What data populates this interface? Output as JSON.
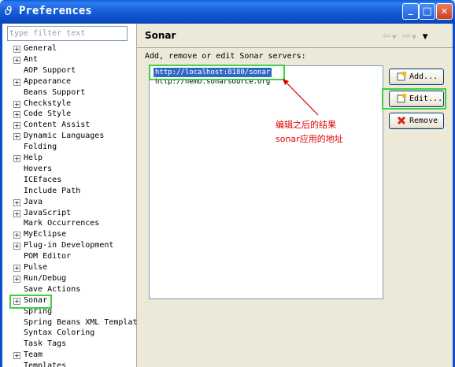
{
  "window": {
    "title": "Preferences",
    "minimize_glyph": "_",
    "maximize_glyph": "□",
    "close_glyph": "✕"
  },
  "filter": {
    "placeholder": "type filter text"
  },
  "tree": {
    "items": [
      {
        "label": "General",
        "expandable": true
      },
      {
        "label": "Ant",
        "expandable": true
      },
      {
        "label": "AOP Support",
        "expandable": false
      },
      {
        "label": "Appearance",
        "expandable": true
      },
      {
        "label": "Beans Support",
        "expandable": false
      },
      {
        "label": "Checkstyle",
        "expandable": true
      },
      {
        "label": "Code Style",
        "expandable": true
      },
      {
        "label": "Content Assist",
        "expandable": true
      },
      {
        "label": "Dynamic Languages",
        "expandable": true
      },
      {
        "label": "Folding",
        "expandable": false
      },
      {
        "label": "Help",
        "expandable": true
      },
      {
        "label": "Hovers",
        "expandable": false
      },
      {
        "label": "ICEfaces",
        "expandable": false
      },
      {
        "label": "Include Path",
        "expandable": false
      },
      {
        "label": "Java",
        "expandable": true
      },
      {
        "label": "JavaScript",
        "expandable": true
      },
      {
        "label": "Mark Occurrences",
        "expandable": false
      },
      {
        "label": "MyEclipse",
        "expandable": true
      },
      {
        "label": "Plug-in Development",
        "expandable": true
      },
      {
        "label": "POM Editor",
        "expandable": false
      },
      {
        "label": "Pulse",
        "expandable": true
      },
      {
        "label": "Run/Debug",
        "expandable": true
      },
      {
        "label": "Save Actions",
        "expandable": false
      },
      {
        "label": "Sonar",
        "expandable": true
      },
      {
        "label": "Spring",
        "expandable": false
      },
      {
        "label": "Spring Beans XML Templat",
        "expandable": false
      },
      {
        "label": "Syntax Coloring",
        "expandable": false
      },
      {
        "label": "Task Tags",
        "expandable": false
      },
      {
        "label": "Team",
        "expandable": true
      },
      {
        "label": "Templates",
        "expandable": false
      }
    ],
    "selected": "Sonar"
  },
  "page": {
    "title": "Sonar",
    "description": "Add, remove or edit Sonar servers:",
    "servers": [
      {
        "url": "http://localhost:8180/sonar",
        "selected": true
      },
      {
        "url": "http://nemo.sonarsource.org",
        "selected": false
      }
    ],
    "buttons": {
      "add": "Add...",
      "edit": "Edit...",
      "remove": "Remove"
    }
  },
  "annotation": {
    "line1": "编辑之后的结果",
    "line2": "sonar应用的地址",
    "color": "#e00000"
  },
  "colors": {
    "titlebar": "#0b4fc9",
    "selection": "#316ac5",
    "highlight_box": "#3fd13f"
  }
}
